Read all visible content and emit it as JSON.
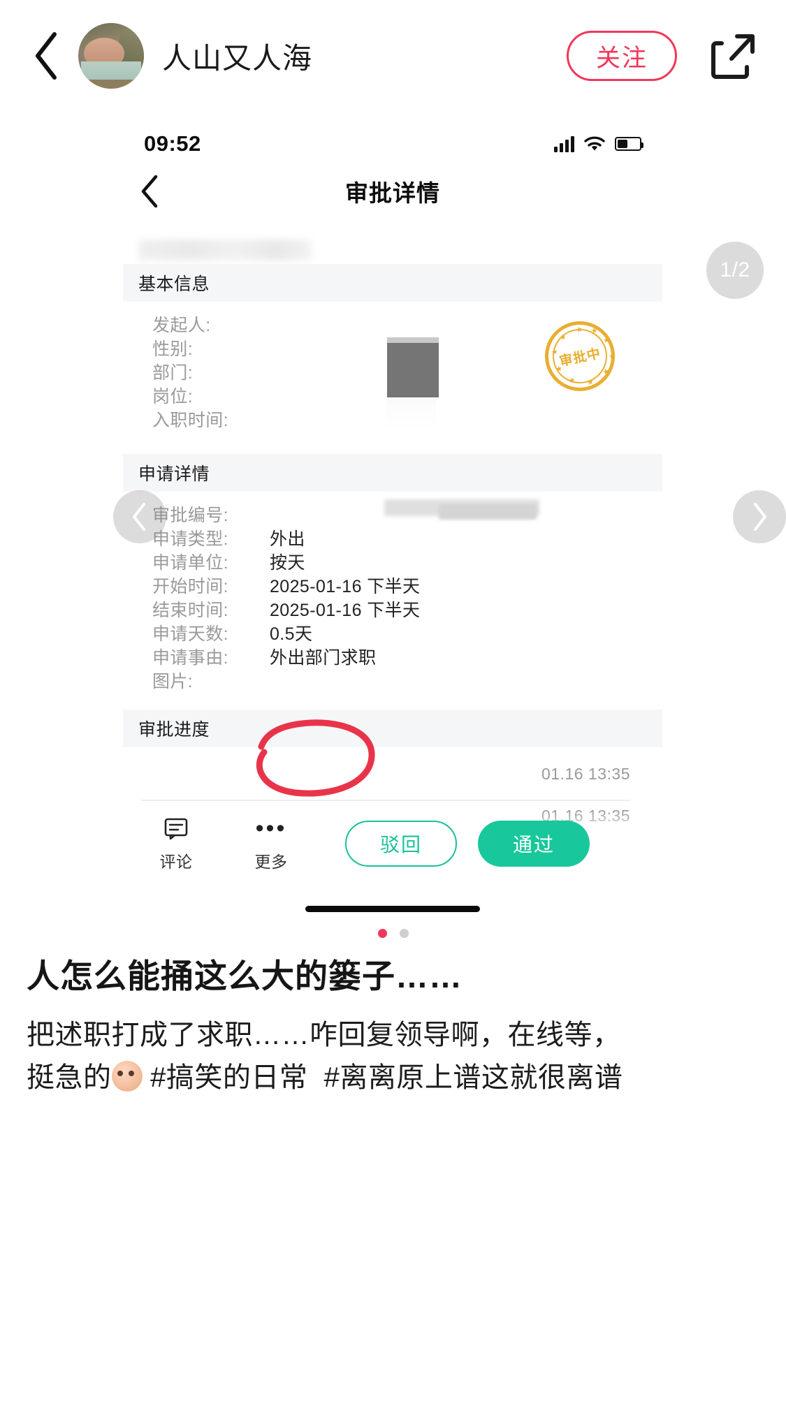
{
  "topbar": {
    "back_icon": "chevron-left-icon",
    "username": "人山又人海",
    "follow_label": "关注",
    "share_icon": "share-external-icon"
  },
  "screenshot": {
    "status": {
      "time": "09:52",
      "signal_icon": "cellular-signal-icon",
      "wifi_icon": "wifi-icon",
      "battery_icon": "battery-icon"
    },
    "nav": {
      "back_icon": "chevron-left-icon",
      "title": "审批详情"
    },
    "basic_info": {
      "section_title": "基本信息",
      "rows": [
        {
          "label": "发起人:",
          "value": ""
        },
        {
          "label": "性别:",
          "value": ""
        },
        {
          "label": "部门:",
          "value": ""
        },
        {
          "label": "岗位:",
          "value": ""
        },
        {
          "label": "入职时间:",
          "value": ""
        }
      ],
      "stamp_text": "审批中"
    },
    "application": {
      "section_title": "申请详情",
      "rows": [
        {
          "label": "审批编号:",
          "value": ""
        },
        {
          "label": "申请类型:",
          "value": "外出"
        },
        {
          "label": "申请单位:",
          "value": "按天"
        },
        {
          "label": "开始时间:",
          "value": "2025-01-16 下半天"
        },
        {
          "label": "结束时间:",
          "value": "2025-01-16 下半天"
        },
        {
          "label": "申请天数:",
          "value": "0.5天"
        },
        {
          "label": "申请事由:",
          "value": "外出部门求职"
        },
        {
          "label": "图片:",
          "value": ""
        }
      ]
    },
    "progress": {
      "section_title": "审批进度",
      "entries": [
        {
          "time": "01.16 13:35"
        },
        {
          "time": "01.16 13:35"
        }
      ]
    },
    "actions": {
      "comment_label": "评论",
      "comment_icon": "comment-icon",
      "more_label": "更多",
      "more_icon": "ellipsis-icon",
      "reject_label": "驳回",
      "pass_label": "通过"
    },
    "carousel": {
      "prev_icon": "chevron-left-icon",
      "next_icon": "chevron-right-icon"
    }
  },
  "overlay": {
    "page_indicator": "1/2",
    "annotation": "red-circle-annotation"
  },
  "pager": {
    "dots": [
      true,
      false
    ]
  },
  "caption": {
    "title": "人怎么能捅这么大的篓子……",
    "line1": "把述职打成了求职……咋回复领导啊，在线等，",
    "line2_prefix": "挺急的",
    "emoji": "crying-face-emoji",
    "tag1": "#搞笑的日常",
    "tag2": "#离离原上谱这就很离谱"
  },
  "colors": {
    "accent_red": "#f2365a",
    "pass_green": "#18c79b",
    "stamp_orange": "#e8a81f"
  }
}
